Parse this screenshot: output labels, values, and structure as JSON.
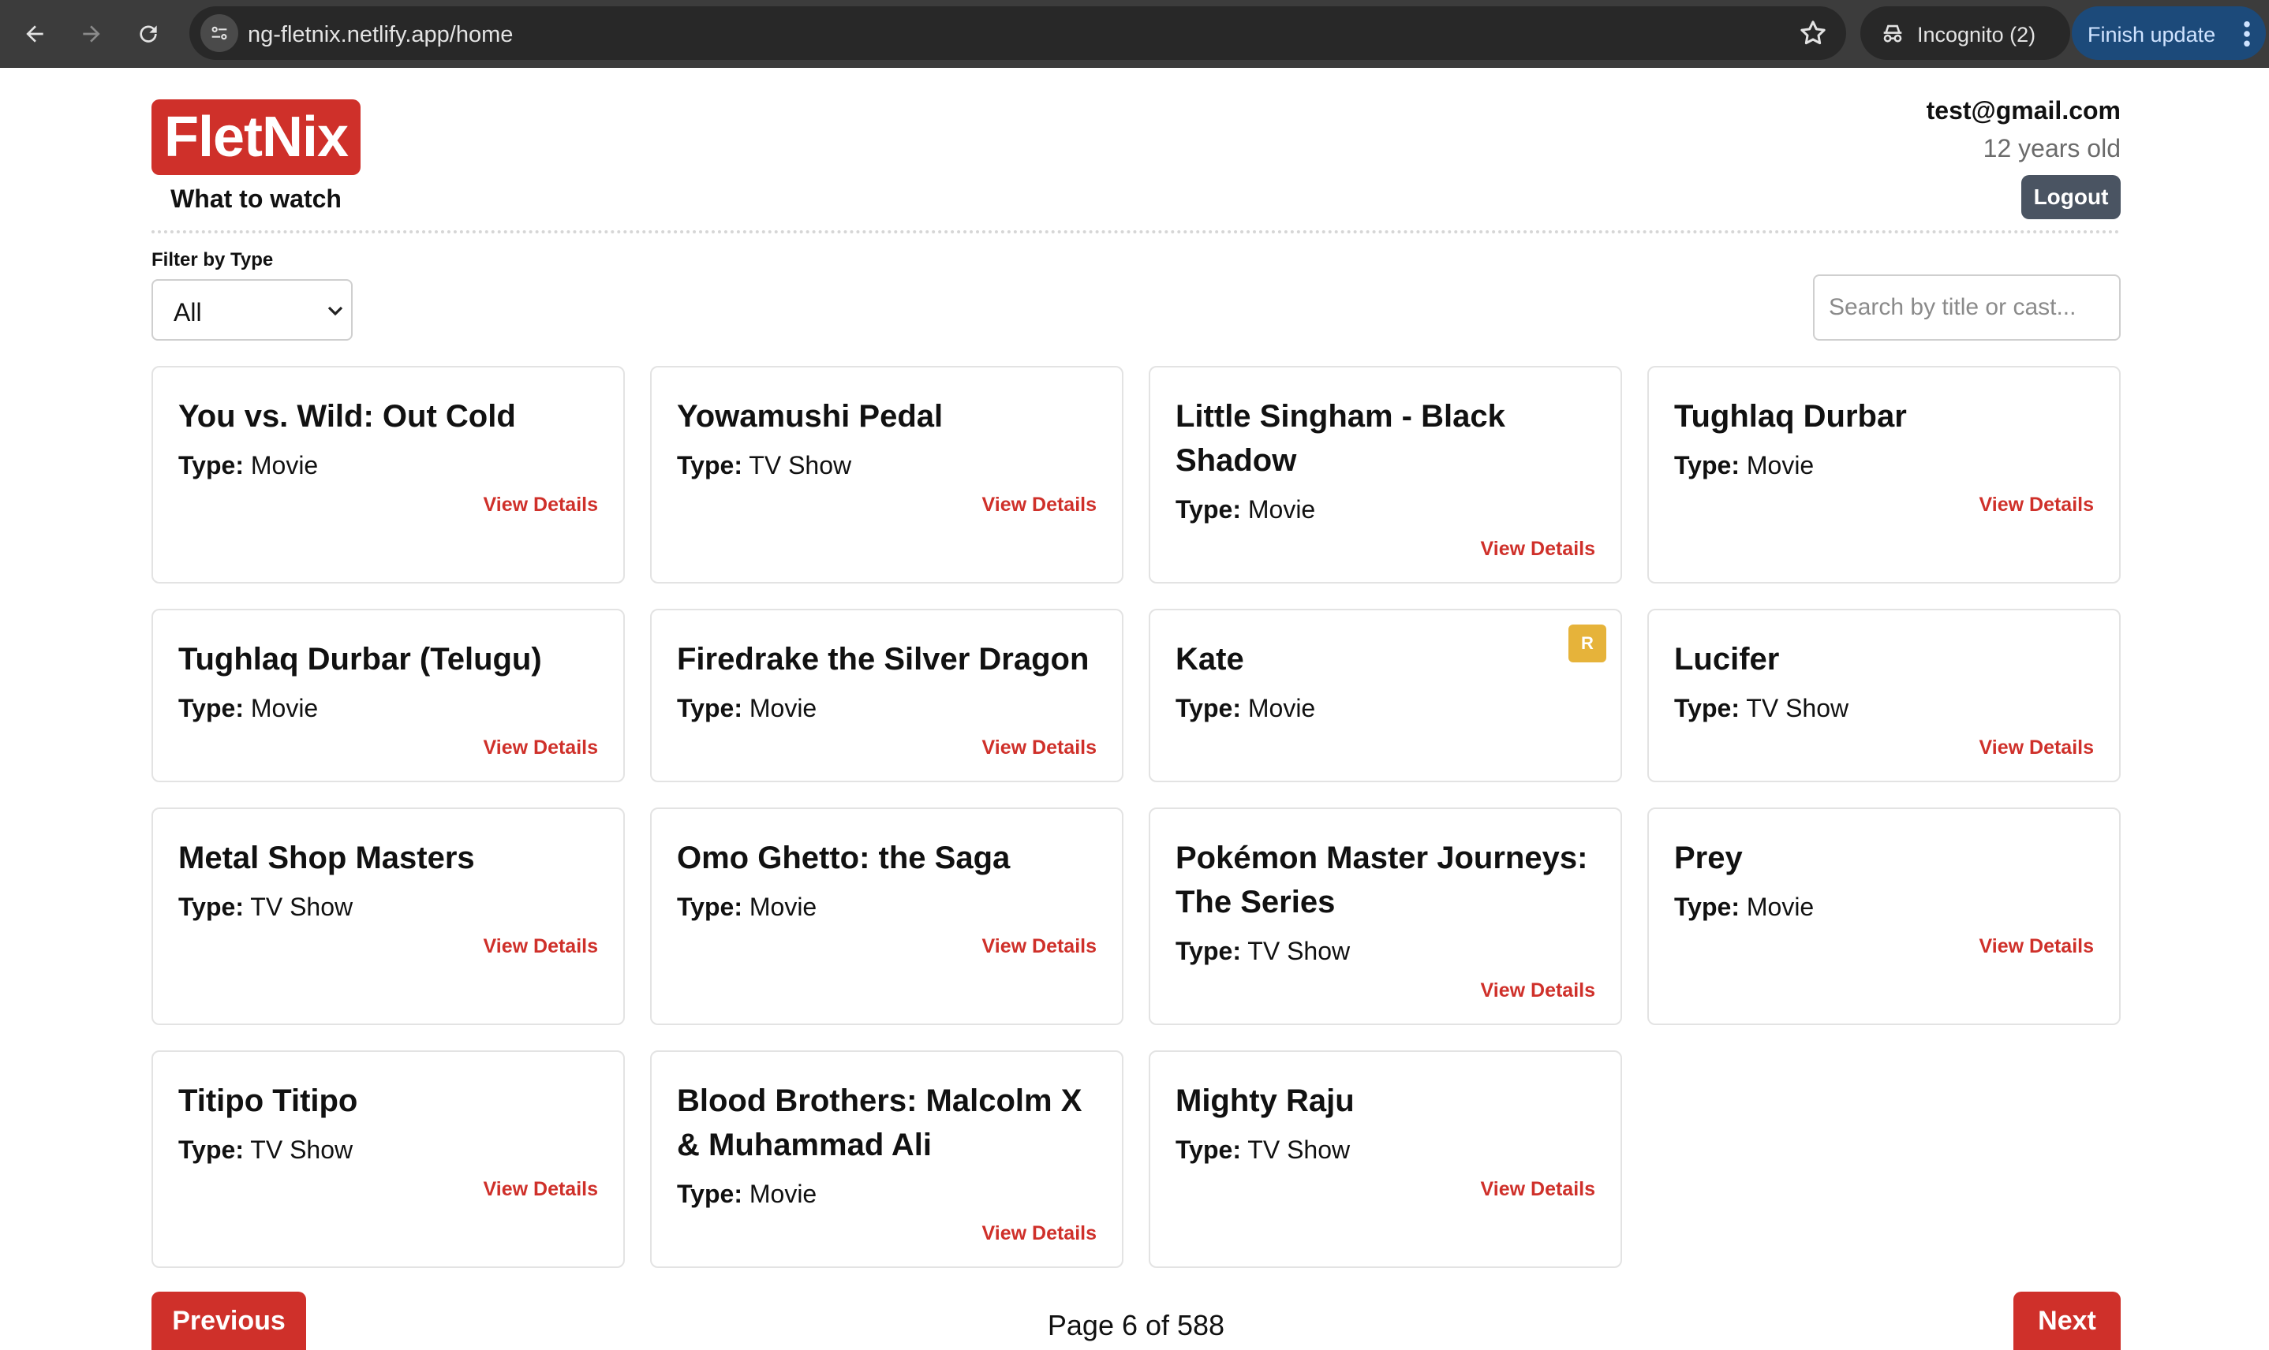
{
  "browser": {
    "url": "ng-fletnix.netlify.app/home",
    "incognito_label": "Incognito (2)",
    "finish_update_label": "Finish update"
  },
  "header": {
    "logo_text": "FletNix",
    "tagline": "What to watch",
    "user_email": "test@gmail.com",
    "user_age": "12 years old",
    "logout_label": "Logout"
  },
  "filters": {
    "type_label": "Filter by Type",
    "type_selected": "All",
    "search_placeholder": "Search by title or cast..."
  },
  "cards": [
    {
      "title": "You vs. Wild: Out Cold",
      "type_label": "Type:",
      "type": "Movie",
      "link": "View Details"
    },
    {
      "title": "Yowamushi Pedal",
      "type_label": "Type:",
      "type": "TV Show",
      "link": "View Details"
    },
    {
      "title": "Little Singham - Black Shadow",
      "type_label": "Type:",
      "type": "Movie",
      "link": "View Details"
    },
    {
      "title": "Tughlaq Durbar",
      "type_label": "Type:",
      "type": "Movie",
      "link": "View Details"
    },
    {
      "title": "Tughlaq Durbar (Telugu)",
      "type_label": "Type:",
      "type": "Movie",
      "link": "View Details"
    },
    {
      "title": "Firedrake the Silver Dragon",
      "type_label": "Type:",
      "type": "Movie",
      "link": "View Details"
    },
    {
      "title": "Kate",
      "type_label": "Type:",
      "type": "Movie",
      "badge": "R"
    },
    {
      "title": "Lucifer",
      "type_label": "Type:",
      "type": "TV Show",
      "link": "View Details"
    },
    {
      "title": "Metal Shop Masters",
      "type_label": "Type:",
      "type": "TV Show",
      "link": "View Details"
    },
    {
      "title": "Omo Ghetto: the Saga",
      "type_label": "Type:",
      "type": "Movie",
      "link": "View Details"
    },
    {
      "title": "Pokémon Master Journeys: The Series",
      "type_label": "Type:",
      "type": "TV Show",
      "link": "View Details"
    },
    {
      "title": "Prey",
      "type_label": "Type:",
      "type": "Movie",
      "link": "View Details"
    },
    {
      "title": "Titipo Titipo",
      "type_label": "Type:",
      "type": "TV Show",
      "link": "View Details"
    },
    {
      "title": "Blood Brothers: Malcolm X & Muhammad Ali",
      "type_label": "Type:",
      "type": "Movie",
      "link": "View Details"
    },
    {
      "title": "Mighty Raju",
      "type_label": "Type:",
      "type": "TV Show",
      "link": "View Details"
    }
  ],
  "pagination": {
    "previous_label": "Previous",
    "next_label": "Next",
    "page_info": "Page 6 of 588"
  },
  "colors": {
    "brand": "#cf302a",
    "badge": "#e6b33a",
    "logout_bg": "#4a5462"
  }
}
